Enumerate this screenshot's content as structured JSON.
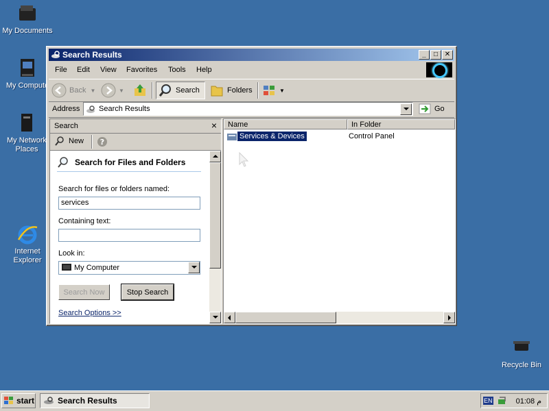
{
  "desktop": {
    "icons": [
      {
        "label": "My Documents"
      },
      {
        "label": "My Compute"
      },
      {
        "label": "My Network Places"
      },
      {
        "label": "Internet Explorer"
      },
      {
        "label": "Recycle Bin"
      }
    ]
  },
  "window": {
    "title": "Search Results",
    "buttons": {
      "minimize": "_",
      "maximize": "□",
      "close": "✕"
    }
  },
  "menu": [
    "File",
    "Edit",
    "View",
    "Favorites",
    "Tools",
    "Help"
  ],
  "toolbar": {
    "back": "Back",
    "search": "Search",
    "folders": "Folders"
  },
  "address": {
    "label": "Address",
    "value": "Search Results",
    "go": "Go"
  },
  "search_pane": {
    "title": "Search",
    "close": "×",
    "new": "New",
    "heading": "Search for Files and Folders",
    "named_label": "Search for files or folders named:",
    "named_value": "services",
    "containing_label": "Containing text:",
    "containing_value": "",
    "look_in_label": "Look in:",
    "look_in_value": "My Computer",
    "search_now": "Search Now",
    "stop_search": "Stop Search",
    "options": "Search Options >>"
  },
  "results": {
    "columns": [
      "Name",
      "In Folder"
    ],
    "rows": [
      {
        "name": "Services & Devices",
        "folder": "Control Panel"
      }
    ]
  },
  "taskbar": {
    "start": "start",
    "item": "Search Results",
    "lang": "EN",
    "clock": "01:08 م"
  },
  "colors": {
    "desktop": "#3a6ea5",
    "title_start": "#0a246a",
    "title_end": "#a6caf0",
    "selection": "#0a246a"
  }
}
